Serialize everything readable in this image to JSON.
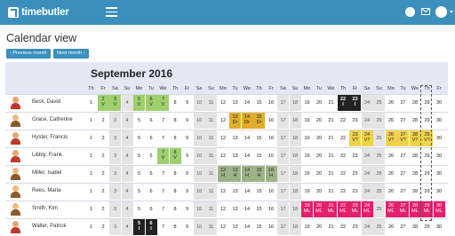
{
  "header": {
    "brand": "timebutler"
  },
  "page": {
    "title": "Calendar view"
  },
  "nav": {
    "prev_label": "‹ Previous month",
    "next_label": "Next month ›"
  },
  "calendar": {
    "month_label": "September 2016",
    "day_letters": [
      "Th",
      "Fr",
      "Sa",
      "Su",
      "Mo",
      "Tu",
      "We",
      "Th",
      "Fr",
      "Sa",
      "Su",
      "Mo",
      "Tu",
      "We",
      "Th",
      "Fr",
      "Sa",
      "Su",
      "Mo",
      "Tu",
      "We",
      "Th",
      "Fr",
      "Sa",
      "Su",
      "Mo",
      "Tu",
      "We",
      "Th",
      "Fr"
    ],
    "employees": [
      {
        "name": "Beck, David",
        "avatar": "male",
        "entries": {
          "2": "V",
          "3": "V",
          "5": "V",
          "6": "V",
          "7": "V",
          "22": "blk",
          "23": "blk"
        }
      },
      {
        "name": "Grace, Catherine",
        "avatar": "female",
        "entries": {
          "13": "Dr",
          "14": "Dr",
          "15": "Dr"
        }
      },
      {
        "name": "Hyster, Francis",
        "avatar": "male",
        "entries": {
          "23": "V?",
          "24": "V?",
          "26": "V?",
          "27": "V?",
          "28": "V?",
          "29": "V?"
        }
      },
      {
        "name": "Libbly, Frank",
        "avatar": "male",
        "entries": {
          "7": "V",
          "8": "V"
        }
      },
      {
        "name": "Miller, Isabel",
        "avatar": "female",
        "entries": {
          "12": "H",
          "13": "H",
          "14": "H",
          "15": "H",
          "16": "H"
        }
      },
      {
        "name": "Rees, Maria",
        "avatar": "female",
        "entries": {}
      },
      {
        "name": "Smith, Kim",
        "avatar": "female",
        "entries": {
          "19": "ML",
          "20": "ML",
          "21": "ML",
          "22": "ML",
          "23": "ML",
          "24": "ML",
          "26": "ML",
          "27": "ML",
          "28": "ML",
          "29": "ML",
          "30": "ML"
        }
      },
      {
        "name": "Walter, Patrick",
        "avatar": "male",
        "entries": {
          "5": "blk",
          "6": "blk"
        }
      }
    ],
    "today": 29
  },
  "colors": {
    "accent": "#3a8fbd",
    "vacation": "#9dd06c",
    "home_office": "#9bb387",
    "doctor": "#e0ad2c",
    "requested": "#f2d24c",
    "maternity": "#e51f6d",
    "blocked": "#222222"
  }
}
